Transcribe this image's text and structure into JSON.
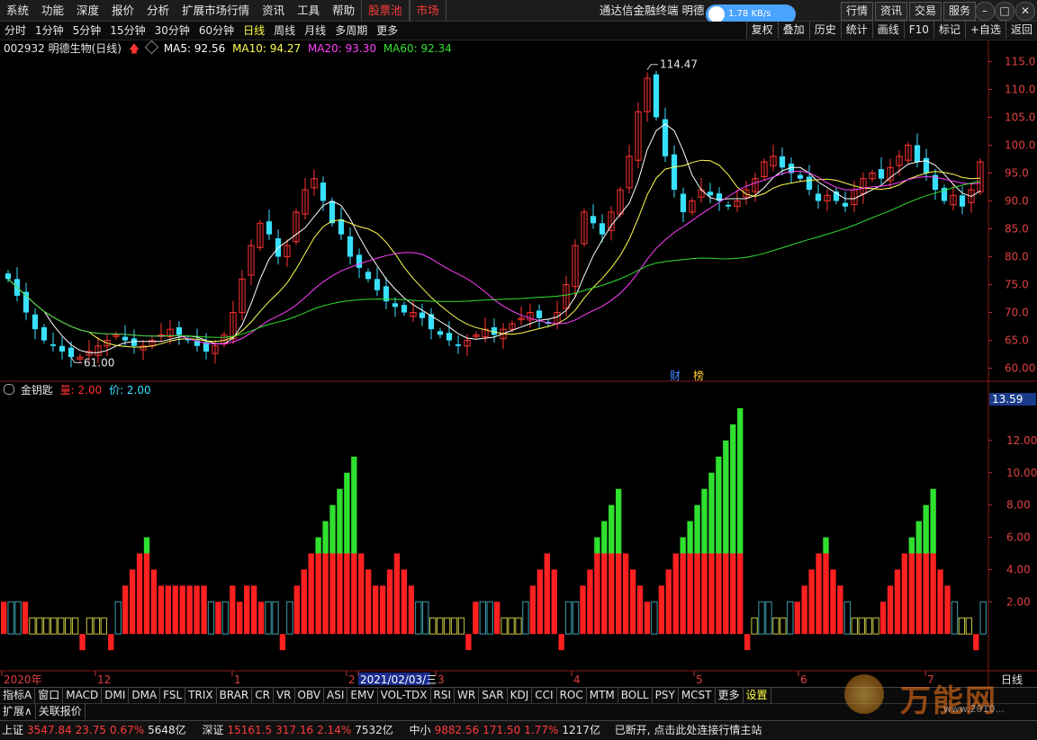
{
  "menu": {
    "items": [
      "系统",
      "功能",
      "深度",
      "报价",
      "分析",
      "扩展市场行情",
      "资讯",
      "工具",
      "帮助"
    ],
    "hot": [
      "股票池",
      "市场"
    ],
    "app_title": "通达信金融终端  明德",
    "speed": "1.78 KB/s",
    "top_buttons": [
      "行情",
      "资讯",
      "交易",
      "服务"
    ],
    "win_buttons": [
      "–",
      "□",
      "✕"
    ]
  },
  "periods": {
    "items": [
      "分时",
      "1分钟",
      "5分钟",
      "15分钟",
      "30分钟",
      "60分钟",
      "日线",
      "周线",
      "月线",
      "多周期",
      "更多"
    ],
    "selected": "日线",
    "right_buttons": [
      "复权",
      "叠加",
      "历史",
      "统计",
      "画线",
      "F10",
      "标记",
      "+自选",
      "返回"
    ]
  },
  "main_legend": {
    "code_name": "002932 明德生物(日线)",
    "ma5": "MA5: 92.56",
    "ma10": "MA10: 94.27",
    "ma20": "MA20: 93.30",
    "ma60": "MA60: 92.34"
  },
  "sub_legend": {
    "name": "金钥匙",
    "vol": "量: 2.00",
    "price": "价: 2.00",
    "max_label": "13.59"
  },
  "annotations": {
    "high": "114.47",
    "low": "61.00",
    "fin": "财",
    "bang": "榜"
  },
  "axis": {
    "price_ticks": [
      "115.0",
      "110.0",
      "105.0",
      "100.0",
      "95.0",
      "90.0",
      "85.0",
      "80.0",
      "75.0",
      "70.0",
      "65.0",
      "60.00"
    ],
    "sub_ticks": [
      "12.00",
      "10.00",
      "8.00",
      "6.00",
      "4.00",
      "2.00"
    ],
    "time_labels": [
      "2020年",
      "12",
      "1",
      "2",
      "2021/02/03/三",
      "3",
      "4",
      "5",
      "6",
      "7"
    ],
    "period_label": "日线"
  },
  "colors": {
    "up": "#ff3333",
    "down": "#38e0ff",
    "ma5": "#ffffff",
    "ma10": "#ffff50",
    "ma20": "#ff40ff",
    "ma60": "#30e030"
  },
  "chart_data": {
    "type": "candlestick",
    "ylim": [
      58,
      117
    ],
    "ma_series": [
      "MA5",
      "MA10",
      "MA20",
      "MA60"
    ],
    "price_path": [
      76,
      73,
      70,
      67,
      65,
      64,
      63,
      62,
      62,
      63,
      64,
      65,
      66,
      65,
      64,
      64,
      65,
      66,
      67,
      66,
      65,
      64,
      63,
      64,
      66,
      70,
      76,
      82,
      86,
      84,
      80,
      82,
      88,
      92,
      94,
      90,
      86,
      84,
      80,
      78,
      76,
      74,
      72,
      71,
      70,
      70,
      69,
      67,
      66,
      65,
      64,
      65,
      66,
      67,
      66,
      67,
      68,
      69,
      70,
      69,
      68,
      70,
      75,
      82,
      88,
      86,
      84,
      88,
      92,
      98,
      106,
      112,
      105,
      98,
      92,
      88,
      90,
      92,
      91,
      90,
      89,
      90,
      92,
      94,
      97,
      98,
      96,
      95,
      94,
      92,
      90,
      91,
      90,
      89,
      92,
      94,
      95,
      94,
      96,
      98,
      100,
      97,
      95,
      92,
      90,
      91,
      89,
      92,
      97
    ]
  },
  "sub_chart": {
    "ylim": [
      -2.5,
      14
    ],
    "values": [
      2,
      2,
      2,
      2,
      1,
      1,
      1,
      1,
      1,
      1,
      1,
      -1,
      1,
      1,
      1,
      -1,
      2,
      3,
      4,
      5,
      6,
      4,
      3,
      3,
      3,
      3,
      3,
      3,
      3,
      2,
      2,
      2,
      3,
      2,
      3,
      3,
      2,
      2,
      2,
      -1,
      2,
      3,
      4,
      5,
      6,
      7,
      8,
      9,
      10,
      11,
      5,
      4,
      3,
      3,
      4,
      5,
      4,
      3,
      2,
      2,
      1,
      1,
      1,
      1,
      1,
      -1,
      2,
      2,
      2,
      2,
      1,
      1,
      1,
      2,
      3,
      4,
      5,
      4,
      -1,
      2,
      2,
      3,
      4,
      6,
      7,
      8,
      9,
      5,
      4,
      3,
      2,
      2,
      3,
      4,
      5,
      6,
      7,
      8,
      9,
      10,
      11,
      12,
      13,
      14,
      -1,
      1,
      2,
      2,
      1,
      1,
      2,
      2,
      3,
      4,
      5,
      6,
      4,
      3,
      2,
      1,
      1,
      1,
      1,
      2,
      3,
      4,
      5,
      6,
      7,
      8,
      9,
      4,
      3,
      2,
      1,
      1,
      -1,
      2
    ]
  },
  "indicators": {
    "tabs": [
      "指标A",
      "窗口",
      "MACD",
      "DMI",
      "DMA",
      "FSL",
      "TRIX",
      "BRAR",
      "CR",
      "VR",
      "OBV",
      "ASI",
      "EMV",
      "VOL-TDX",
      "RSI",
      "WR",
      "SAR",
      "KDJ",
      "CCI",
      "ROC",
      "MTM",
      "BOLL",
      "PSY",
      "MCST",
      "更多",
      "设置"
    ],
    "selected": "设置",
    "ext_tabs": [
      "扩展∧",
      "关联报价"
    ]
  },
  "status": {
    "sh_label": "上证",
    "sh_value": "3547.84",
    "sh_change": "23.75",
    "sh_pct": "0.67%",
    "sh_amount": "5648亿",
    "sz_label": "深证",
    "sz_value": "15161.5",
    "sz_change": "317.16",
    "sz_pct": "2.14%",
    "sz_amount": "7532亿",
    "zx_label": "中小",
    "zx_value": "9882.56",
    "zx_change": "171.50",
    "zx_pct": "1.77%",
    "zx_amount": "1217亿",
    "conn": "已断开, 点击此处连接行情主站",
    "watermark": "万能网",
    "watermark_url": "www.2010..."
  }
}
